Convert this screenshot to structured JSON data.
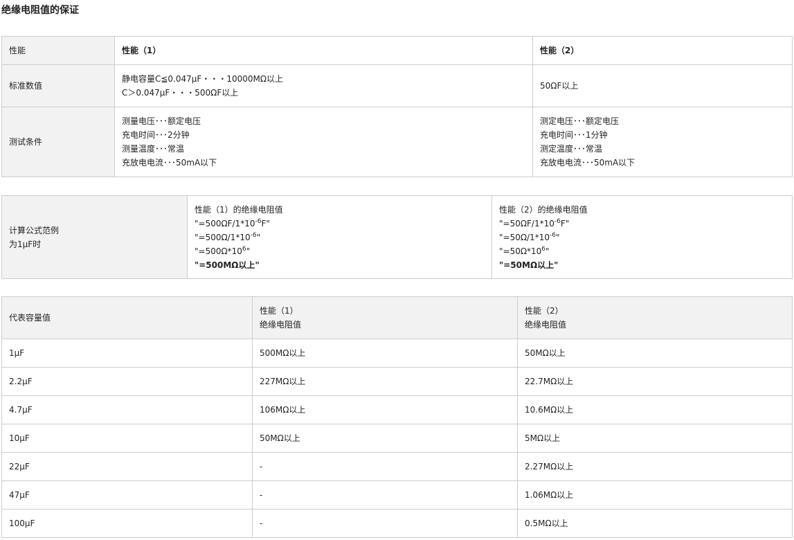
{
  "page_title": "绝缘电阻值的保证",
  "spec_table": {
    "header": {
      "label": "性能",
      "col1": "性能（1）",
      "col2": "性能（2）"
    },
    "standard": {
      "label": "标准数值",
      "col1": [
        "静电容量C≦0.047μF・・・10000MΩ以上",
        "C＞0.047μF・・・500ΩF以上"
      ],
      "col2": "50ΩF以上"
    },
    "test": {
      "label": "测试条件",
      "col1": [
        "测量电压･･･额定电压",
        "充电时间･･･2分钟",
        "测量温度･･･常温",
        "充放电电流･･･50mA以下"
      ],
      "col2": [
        "测定电压･･･额定电压",
        "充电时间･･･1分钟",
        "测定温度･･･常温",
        "充放电电流･･･50mA以下"
      ]
    }
  },
  "formula_table": {
    "label_line1": "计算公式范例",
    "label_line2": "为1μF时",
    "col1": {
      "title": "性能（1）的绝缘电阻值",
      "l1_pre": "\"=500ΩF/1*10",
      "l1_sup": "-6",
      "l1_post": "F\"",
      "l2_pre": "\"=500Ω/1*10",
      "l2_sup": "-6",
      "l2_post": "\"",
      "l3_pre": "\"=500Ω*10",
      "l3_sup": "6",
      "l3_post": "\"",
      "result": "\"=500MΩ以上\""
    },
    "col2": {
      "title": "性能（2）的绝缘电阻值",
      "l1_pre": "\"=50ΩF/1*10",
      "l1_sup": "-6",
      "l1_post": "F\"",
      "l2_pre": "\"=50Ω/1*10",
      "l2_sup": "-6",
      "l2_post": "\"",
      "l3_pre": "\"=50Ω*10",
      "l3_sup": "6",
      "l3_post": "\"",
      "result": "\"=50MΩ以上\""
    }
  },
  "values_table": {
    "header": {
      "col0": "代表容量值",
      "col1_line1": "性能（1）",
      "col1_line2": "绝缘电阻值",
      "col2_line1": "性能（2）",
      "col2_line2": "绝缘电阻值"
    },
    "rows": [
      [
        "1μF",
        "500MΩ以上",
        "50MΩ以上"
      ],
      [
        "2.2μF",
        "227MΩ以上",
        "22.7MΩ以上"
      ],
      [
        "4.7μF",
        "106MΩ以上",
        "10.6MΩ以上"
      ],
      [
        "10μF",
        "50MΩ以上",
        "5MΩ以上"
      ],
      [
        "22μF",
        "-",
        "2.27MΩ以上"
      ],
      [
        "47μF",
        "-",
        "1.06MΩ以上"
      ],
      [
        "100μF",
        "-",
        "0.5MΩ以上"
      ]
    ]
  }
}
